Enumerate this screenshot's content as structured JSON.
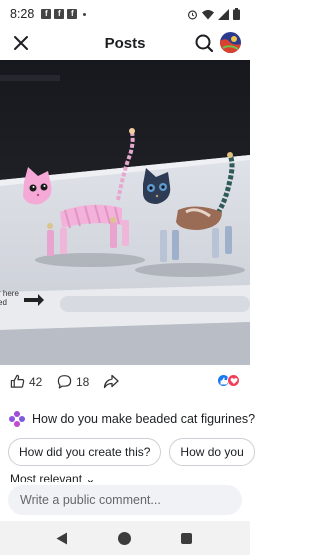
{
  "status_bar": {
    "time": "8:28",
    "app_icons": [
      "f",
      "f",
      "f"
    ]
  },
  "header": {
    "title": "Posts"
  },
  "reactions": {
    "like_count": "42",
    "comment_count": "18"
  },
  "ai_prompt": {
    "question": "How do you make beaded cat figurines?"
  },
  "suggestions": [
    "How did you create this?",
    "How do you"
  ],
  "comments": {
    "sort_label": "Most relevant",
    "placeholder": "Write a public comment..."
  },
  "colors": {
    "like_blue": "#1877f2",
    "love_red": "#f33e58",
    "ai_purple": "#a24bd6"
  }
}
